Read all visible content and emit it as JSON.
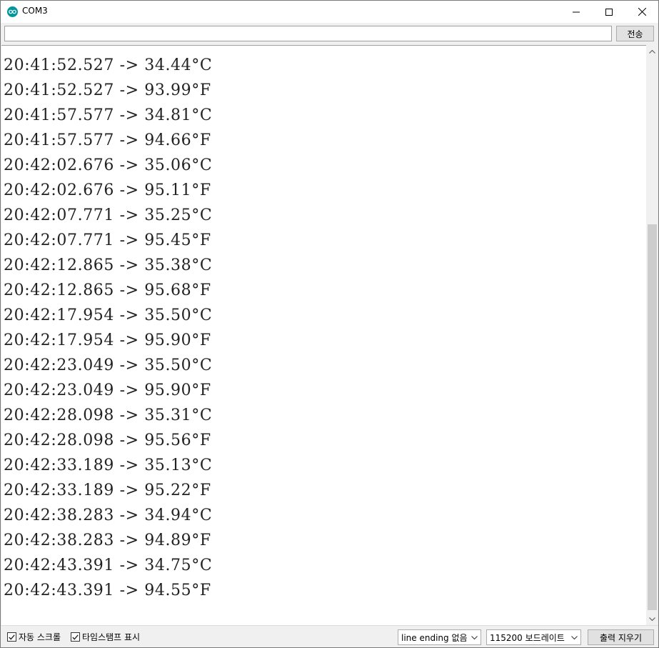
{
  "window": {
    "title": "COM3"
  },
  "send": {
    "input_value": "",
    "button_label": "전송"
  },
  "output": {
    "lines": [
      "20:41:52.527 -> 34.44°C",
      "20:41:52.527 -> 93.99°F",
      "20:41:57.577 -> 34.81°C",
      "20:41:57.577 -> 94.66°F",
      "20:42:02.676 -> 35.06°C",
      "20:42:02.676 -> 95.11°F",
      "20:42:07.771 -> 35.25°C",
      "20:42:07.771 -> 95.45°F",
      "20:42:12.865 -> 35.38°C",
      "20:42:12.865 -> 95.68°F",
      "20:42:17.954 -> 35.50°C",
      "20:42:17.954 -> 95.90°F",
      "20:42:23.049 -> 35.50°C",
      "20:42:23.049 -> 95.90°F",
      "20:42:28.098 -> 35.31°C",
      "20:42:28.098 -> 95.56°F",
      "20:42:33.189 -> 35.13°C",
      "20:42:33.189 -> 95.22°F",
      "20:42:38.283 -> 34.94°C",
      "20:42:38.283 -> 94.89°F",
      "20:42:43.391 -> 34.75°C",
      "20:42:43.391 -> 94.55°F"
    ]
  },
  "bottom": {
    "autoscroll_label": "자동 스크롤",
    "autoscroll_checked": true,
    "timestamp_label": "타임스탬프 표시",
    "timestamp_checked": true,
    "line_ending_value": "line ending 없음",
    "baud_value": "115200 보드레이트",
    "clear_label": "출력 지우기"
  },
  "colors": {
    "app_icon": "#00979c",
    "scroll_thumb": "#cdcdcd"
  }
}
